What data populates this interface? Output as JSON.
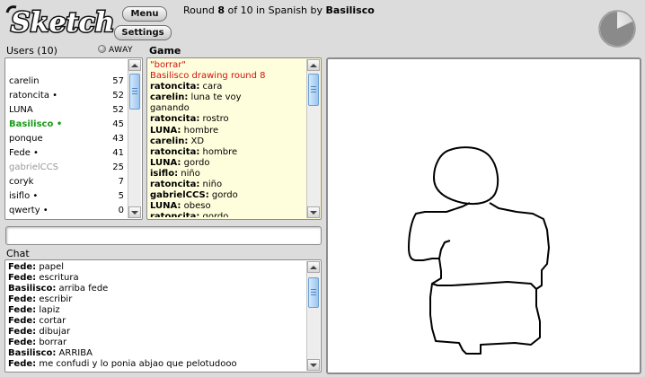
{
  "app": {
    "logo_text": "Sketch",
    "menu_label": "Menu",
    "settings_label": "Settings"
  },
  "round": {
    "prefix": "Round ",
    "current": "8",
    "middle": " of 10 in Spanish by ",
    "drawer": "Basilisco",
    "timer_remaining_fraction": 0.82
  },
  "users": {
    "header": "Users (10)",
    "away_label": "AWAY",
    "list": [
      {
        "name": "carelin",
        "score": "57",
        "style": "normal"
      },
      {
        "name": "ratoncita •",
        "score": "52",
        "style": "normal"
      },
      {
        "name": "LUNA",
        "score": "52",
        "style": "normal"
      },
      {
        "name": "Basilisco •",
        "score": "45",
        "style": "green"
      },
      {
        "name": "ponque",
        "score": "43",
        "style": "normal"
      },
      {
        "name": "Fede •",
        "score": "41",
        "style": "normal"
      },
      {
        "name": "gabrielCCS",
        "score": "25",
        "style": "grey"
      },
      {
        "name": "coryk",
        "score": "7",
        "style": "normal"
      },
      {
        "name": "isiflo •",
        "score": "5",
        "style": "normal"
      },
      {
        "name": "qwerty •",
        "score": "0",
        "style": "normal"
      }
    ]
  },
  "game": {
    "header": "Game",
    "lines": [
      {
        "user": "",
        "text": "\"borrar\"",
        "style": "red"
      },
      {
        "user": "",
        "text": "Basilisco drawing round 8",
        "style": "red"
      },
      {
        "user": "ratoncita:",
        "text": " cara",
        "style": "normal"
      },
      {
        "user": "carelin:",
        "text": " luna te voy",
        "style": "normal"
      },
      {
        "user": "",
        "text": "ganando",
        "style": "normal"
      },
      {
        "user": "ratoncita:",
        "text": " rostro",
        "style": "normal"
      },
      {
        "user": "LUNA:",
        "text": " hombre",
        "style": "normal"
      },
      {
        "user": "carelin:",
        "text": " XD",
        "style": "normal"
      },
      {
        "user": "ratoncita:",
        "text": " hombre",
        "style": "normal"
      },
      {
        "user": "LUNA:",
        "text": " gordo",
        "style": "normal"
      },
      {
        "user": "isiflo:",
        "text": " niño",
        "style": "normal"
      },
      {
        "user": "ratoncita:",
        "text": " niño",
        "style": "normal"
      },
      {
        "user": "gabrielCCS:",
        "text": " gordo",
        "style": "normal"
      },
      {
        "user": "LUNA:",
        "text": " obeso",
        "style": "normal"
      },
      {
        "user": "ratoncita:",
        "text": " gordo",
        "style": "normal"
      }
    ]
  },
  "guess_input": {
    "value": "",
    "placeholder": ""
  },
  "chat": {
    "header": "Chat",
    "lines": [
      {
        "user": "Fede:",
        "text": " papel"
      },
      {
        "user": "Fede:",
        "text": " escritura"
      },
      {
        "user": "Basilisco:",
        "text": " arriba fede"
      },
      {
        "user": "Fede:",
        "text": " escribir"
      },
      {
        "user": "Fede:",
        "text": " lapiz"
      },
      {
        "user": "Fede:",
        "text": " cortar"
      },
      {
        "user": "Fede:",
        "text": " dibujar"
      },
      {
        "user": "Fede:",
        "text": " borrar"
      },
      {
        "user": "Basilisco:",
        "text": " ARRIBA"
      },
      {
        "user": "Fede:",
        "text": " me confudi y lo ponia abjao que pelotudooo"
      }
    ]
  },
  "colors": {
    "background": "#dcdcdc",
    "game_panel_bg": "#fffedc",
    "system_text": "#d01010",
    "drawer_name": "#1a9c1a",
    "away_user": "#999999"
  }
}
